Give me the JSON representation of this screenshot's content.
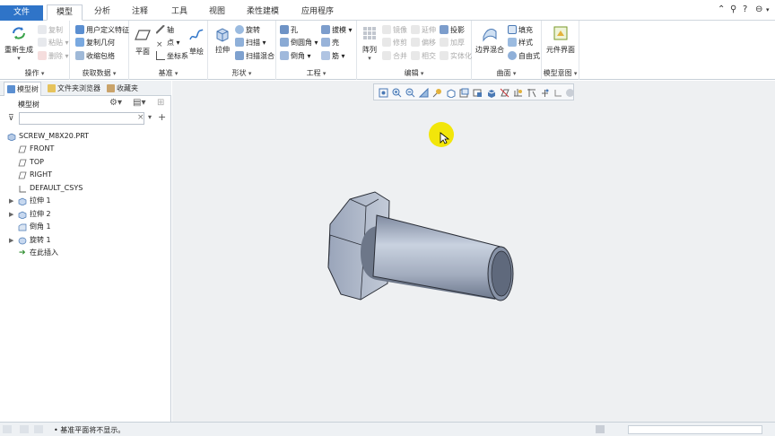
{
  "tabs": [
    {
      "label": "文件"
    },
    {
      "label": "模型"
    },
    {
      "label": "分析"
    },
    {
      "label": "注释"
    },
    {
      "label": "工具"
    },
    {
      "label": "视图"
    },
    {
      "label": "柔性建模"
    },
    {
      "label": "应用程序"
    }
  ],
  "ribbon": {
    "ops": {
      "regen": "重新生成",
      "copy": "复制",
      "paste": "粘贴",
      "delete": "删除",
      "label": "操作"
    },
    "getdata": {
      "udf": "用户定义特征",
      "copygeo": "复制几何",
      "shrink": "收缩包络",
      "label": "获取数据"
    },
    "datum": {
      "plane": "平面",
      "axis": "轴",
      "point": "点",
      "csys": "坐标系",
      "sketch": "草绘",
      "label": "基准"
    },
    "shapes": {
      "extrude": "拉伸",
      "revolve": "旋转",
      "sweep": "扫描",
      "swept_blend": "扫描混合",
      "label": "形状"
    },
    "eng": {
      "hole": "孔",
      "round": "倒圆角",
      "chamfer": "倒角",
      "draft": "拔模",
      "shell": "壳",
      "rib": "筋",
      "label": "工程"
    },
    "edit": {
      "pattern": "阵列",
      "mirror": "镜像",
      "trim": "修剪",
      "merge": "合并",
      "extend": "延伸",
      "offset": "偏移",
      "intersect": "相交",
      "project": "投影",
      "thicken": "加厚",
      "solidify": "实体化",
      "label": "编辑"
    },
    "surf": {
      "boundary": "边界混合",
      "fill": "填充",
      "style": "样式",
      "freestyle": "自由式",
      "label": "曲面"
    },
    "intent": {
      "component_interface": "元件界面",
      "label": "模型意图"
    }
  },
  "panel": {
    "tabs": [
      {
        "label": "模型树"
      },
      {
        "label": "文件夹浏览器"
      },
      {
        "label": "收藏夹"
      }
    ],
    "header": "模型树",
    "search_placeholder": "",
    "items": [
      {
        "label": "SCREW_M8X20.PRT"
      },
      {
        "label": "FRONT"
      },
      {
        "label": "TOP"
      },
      {
        "label": "RIGHT"
      },
      {
        "label": "DEFAULT_CSYS"
      },
      {
        "label": "拉伸 1"
      },
      {
        "label": "拉伸 2"
      },
      {
        "label": "倒角 1"
      },
      {
        "label": "旋转 1"
      },
      {
        "label": "在此插入"
      }
    ]
  },
  "status": {
    "message": "• 基准平面将不显示。"
  },
  "colors": {
    "file_tab": "#2f74c8",
    "cursor_highlight": "#f2e60a",
    "bolt": "#a9b4c6"
  }
}
